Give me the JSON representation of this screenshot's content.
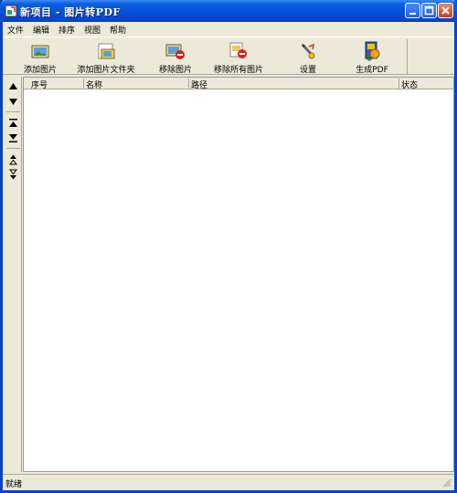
{
  "window": {
    "title": "新项目 - 图片转PDF"
  },
  "menu": [
    "文件",
    "编辑",
    "排序",
    "视图",
    "帮助"
  ],
  "toolbar": {
    "add_image": "添加图片",
    "add_folder": "添加图片文件夹",
    "remove_image": "移除图片",
    "remove_all": "移除所有图片",
    "settings": "设置",
    "generate_pdf": "生成PDF"
  },
  "list": {
    "columns": [
      "序号",
      "名称",
      "路径",
      "状态"
    ],
    "rows": []
  },
  "status": {
    "text": "就绪"
  }
}
